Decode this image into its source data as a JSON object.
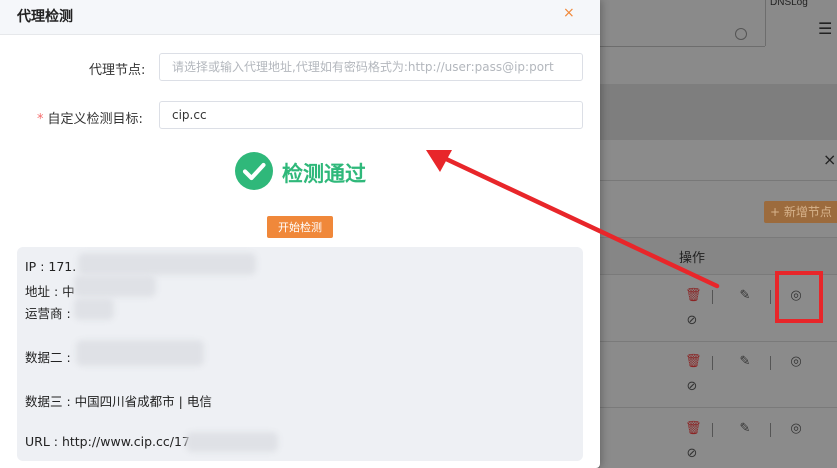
{
  "dialog": {
    "title": "代理检测",
    "close_symbol": "×",
    "proxy_label": "代理节点:",
    "proxy_placeholder": "请选择或输入代理地址,代理如有密码格式为:http://user:pass@ip:port",
    "target_required_mark": "*",
    "target_label": "自定义检测目标:",
    "target_value": "cip.cc",
    "status_text": "检测通过",
    "start_button": "开始检测",
    "result_lines": {
      "ip": "IP : 171.",
      "addr": "地址 : 中",
      "isp": "运营商 :",
      "data2": "数据二 :",
      "data3": "数据三 : 中国四川省成都市 | 电信",
      "url": "URL : http://www.cip.cc/17"
    }
  },
  "background": {
    "dnslog_tab": "DNSLog",
    "add_node_button": "+ 新增节点",
    "ops_header": "操作"
  },
  "icons": {
    "delete": "trash-icon",
    "edit": "edit-icon",
    "detect": "detect-icon",
    "disable": "ban-icon",
    "check": "check-circle-icon",
    "close": "close-icon",
    "menu": "menu-icon"
  },
  "colors": {
    "accent": "#f0883a",
    "success": "#2fb87a",
    "annotation": "#e8262a",
    "delete": "#d9363e"
  }
}
